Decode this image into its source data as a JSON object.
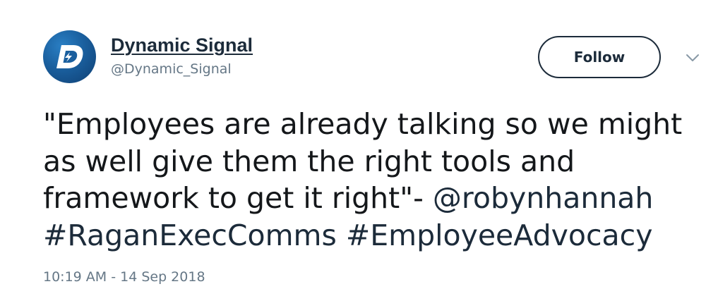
{
  "account": {
    "display_name": "Dynamic Signal",
    "handle": "@Dynamic_Signal",
    "avatar_letter": "D",
    "avatar_color": "#1a5f9e"
  },
  "actions": {
    "follow_label": "Follow",
    "more_icon": "chevron-down-icon"
  },
  "tweet": {
    "line1": "\"Employees are already talking so we might",
    "line2": "as well give them the right tools and",
    "line3_prefix": "framework to get it right\"- ",
    "mention": "@robynhannah",
    "hashtag1": "#RaganExecComms",
    "hashtag2": "#EmployeeAdvocacy",
    "timestamp": "10:19 AM - 14 Sep 2018"
  },
  "colors": {
    "text": "#14171a",
    "link": "#1c2b3a",
    "muted": "#657786"
  }
}
